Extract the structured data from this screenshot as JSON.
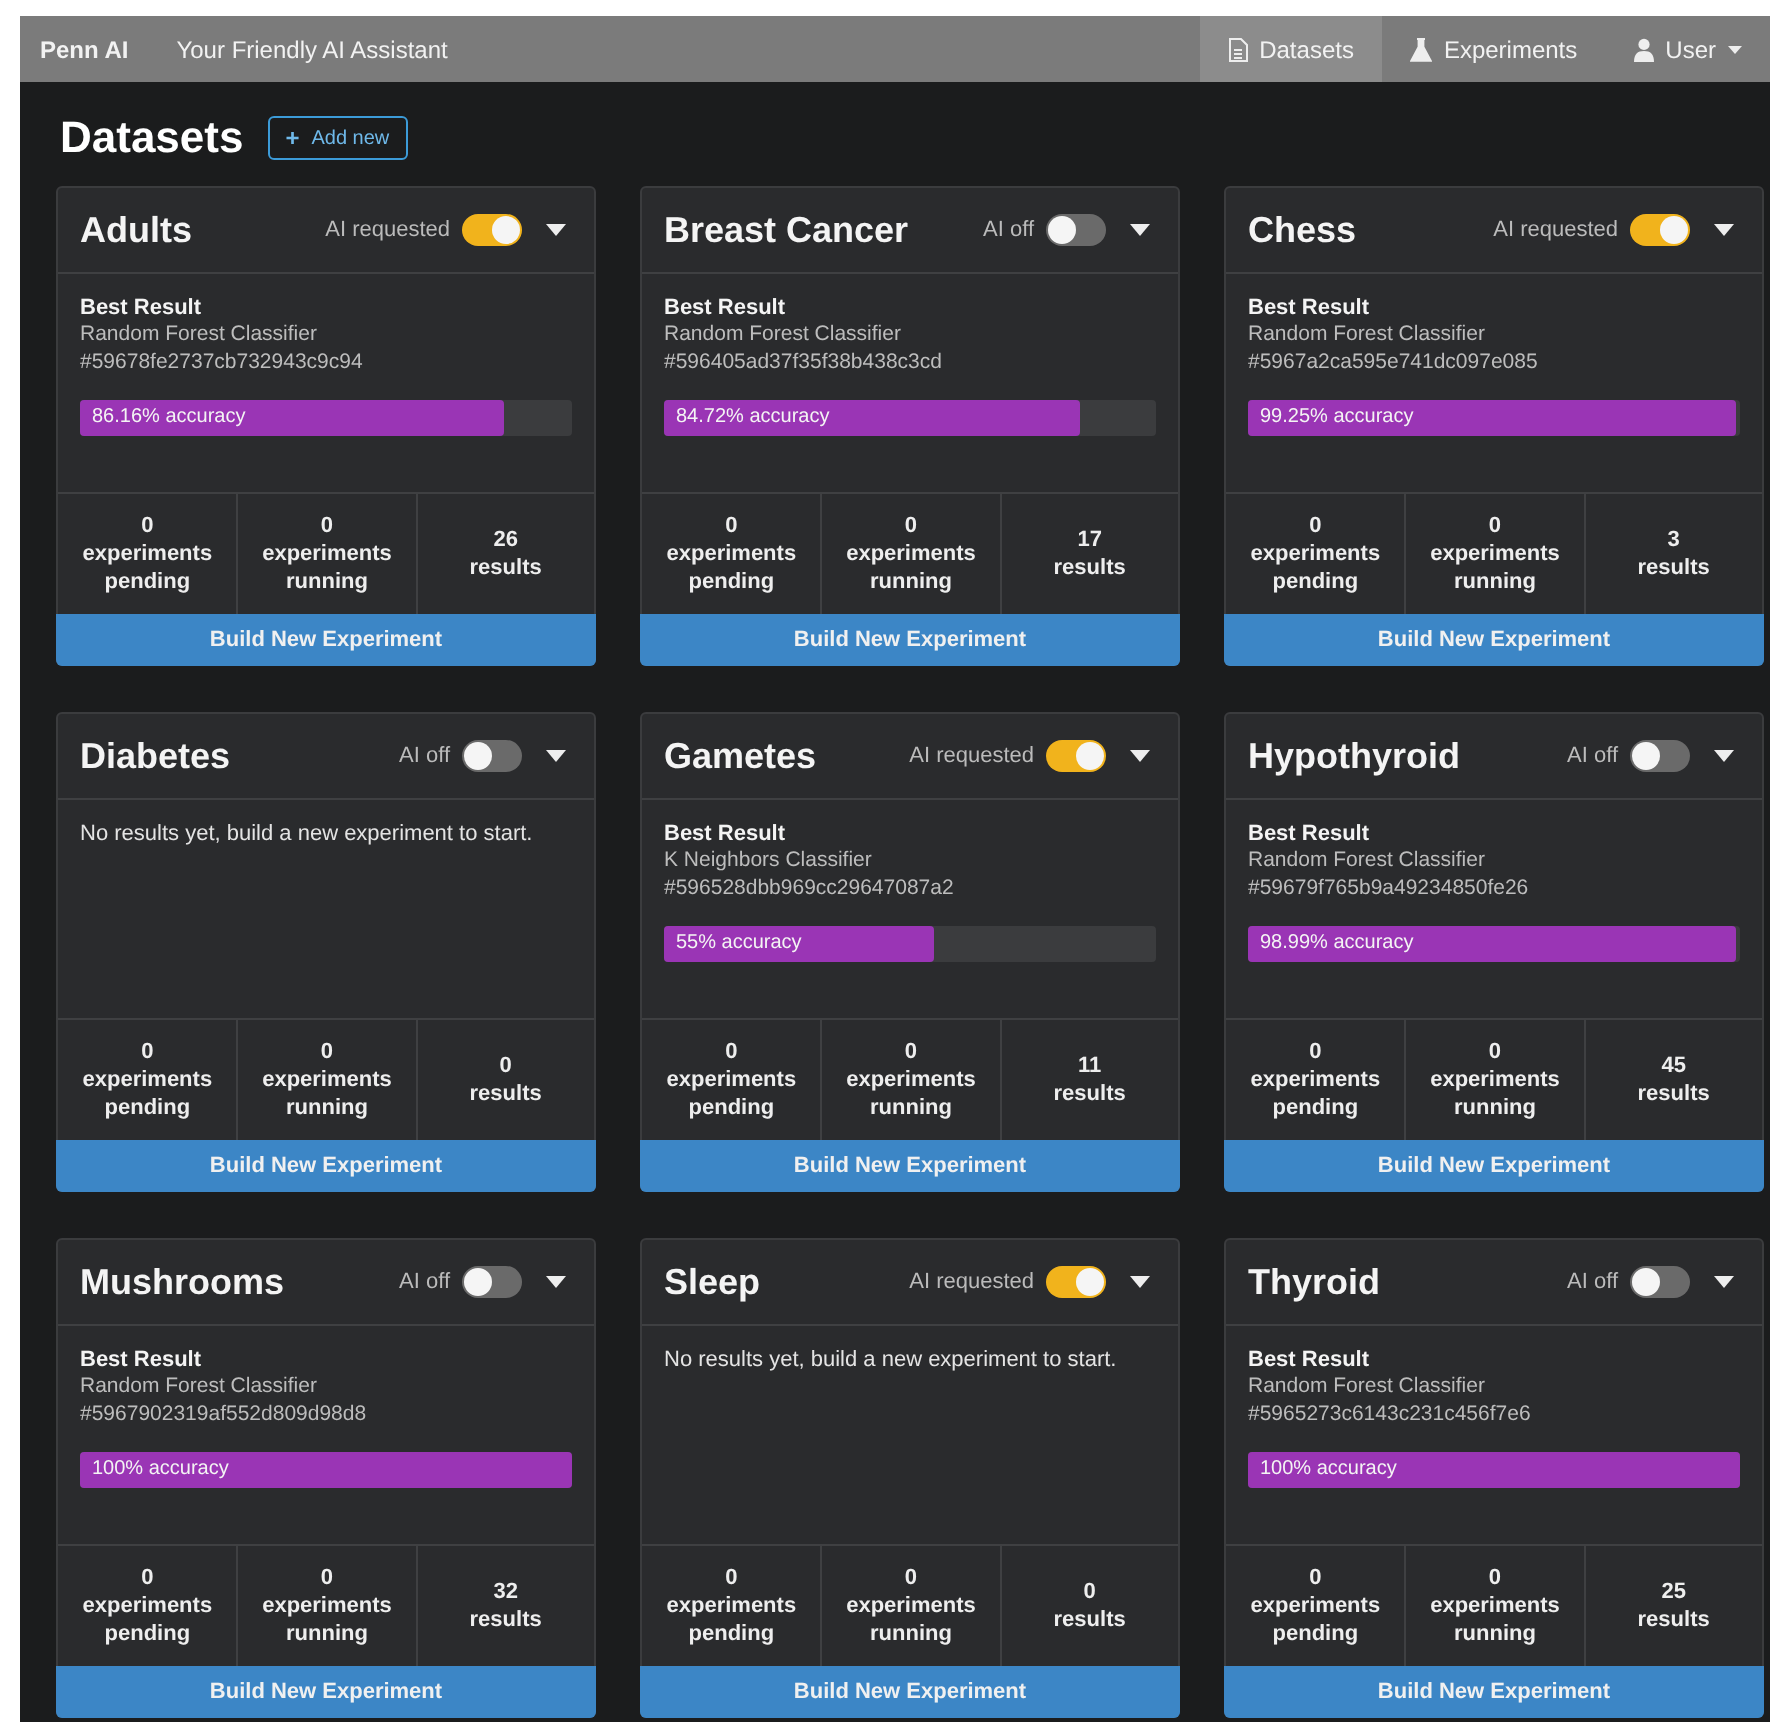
{
  "navbar": {
    "brand": "Penn AI",
    "tagline": "Your Friendly AI Assistant",
    "items": [
      {
        "label": "Datasets",
        "selected": true,
        "caret": false
      },
      {
        "label": "Experiments",
        "selected": false,
        "caret": false
      },
      {
        "label": "User",
        "selected": false,
        "caret": true
      }
    ]
  },
  "page": {
    "title": "Datasets",
    "add_button": "Add new",
    "add_icon": "+"
  },
  "datasets": [
    {
      "name": "Adults",
      "ai_label": "AI requested",
      "ai_on": true,
      "best_result": {
        "heading": "Best Result",
        "algorithm": "Random Forest Classifier",
        "id": "#59678fe2737cb732943c9c94",
        "accuracy": "86.16%  accuracy",
        "level": 0.8616
      },
      "stats": [
        {
          "value": "0",
          "label": "experiments pending"
        },
        {
          "value": "0",
          "label": "experiments running"
        },
        {
          "value": "26",
          "label": "results"
        }
      ],
      "button": "Build New Experiment"
    },
    {
      "name": "Breast Cancer",
      "ai_label": "AI off",
      "ai_on": false,
      "best_result": {
        "heading": "Best Result",
        "algorithm": "Random Forest Classifier",
        "id": "#596405ad37f35f38b438c3cd",
        "accuracy": "84.72%  accuracy",
        "level": 0.8472
      },
      "stats": [
        {
          "value": "0",
          "label": "experiments pending"
        },
        {
          "value": "0",
          "label": "experiments running"
        },
        {
          "value": "17",
          "label": "results"
        }
      ],
      "button": "Build New Experiment"
    },
    {
      "name": "Chess",
      "ai_label": "AI requested",
      "ai_on": true,
      "best_result": {
        "heading": "Best Result",
        "algorithm": "Random Forest Classifier",
        "id": "#5967a2ca595e741dc097e085",
        "accuracy": "99.25%  accuracy",
        "level": 0.9925
      },
      "stats": [
        {
          "value": "0",
          "label": "experiments pending"
        },
        {
          "value": "0",
          "label": "experiments running"
        },
        {
          "value": "3",
          "label": "results"
        }
      ],
      "button": "Build New Experiment"
    },
    {
      "name": "Diabetes",
      "ai_label": "AI off",
      "ai_on": false,
      "empty_message": "No results yet, build a new experiment to start.",
      "stats": [
        {
          "value": "0",
          "label": "experiments pending"
        },
        {
          "value": "0",
          "label": "experiments running"
        },
        {
          "value": "0",
          "label": "results"
        }
      ],
      "button": "Build New Experiment"
    },
    {
      "name": "Gametes",
      "ai_label": "AI requested",
      "ai_on": true,
      "best_result": {
        "heading": "Best Result",
        "algorithm": "K Neighbors Classifier",
        "id": "#596528dbb969cc29647087a2",
        "accuracy": "55%  accuracy",
        "level": 0.55
      },
      "stats": [
        {
          "value": "0",
          "label": "experiments pending"
        },
        {
          "value": "0",
          "label": "experiments running"
        },
        {
          "value": "11",
          "label": "results"
        }
      ],
      "button": "Build New Experiment"
    },
    {
      "name": "Hypothyroid",
      "ai_label": "AI off",
      "ai_on": false,
      "best_result": {
        "heading": "Best Result",
        "algorithm": "Random Forest Classifier",
        "id": "#59679f765b9a49234850fe26",
        "accuracy": "98.99%  accuracy",
        "level": 0.9899
      },
      "stats": [
        {
          "value": "0",
          "label": "experiments pending"
        },
        {
          "value": "0",
          "label": "experiments running"
        },
        {
          "value": "45",
          "label": "results"
        }
      ],
      "button": "Build New Experiment"
    },
    {
      "name": "Mushrooms",
      "ai_label": "AI off",
      "ai_on": false,
      "best_result": {
        "heading": "Best Result",
        "algorithm": "Random Forest Classifier",
        "id": "#5967902319af552d809d98d8",
        "accuracy": "100%  accuracy",
        "level": 1
      },
      "stats": [
        {
          "value": "0",
          "label": "experiments pending"
        },
        {
          "value": "0",
          "label": "experiments running"
        },
        {
          "value": "32",
          "label": "results"
        }
      ],
      "button": "Build New Experiment"
    },
    {
      "name": "Sleep",
      "ai_label": "AI requested",
      "ai_on": true,
      "empty_message": "No results yet, build a new experiment to start.",
      "stats": [
        {
          "value": "0",
          "label": "experiments pending"
        },
        {
          "value": "0",
          "label": "experiments running"
        },
        {
          "value": "0",
          "label": "results"
        }
      ],
      "button": "Build New Experiment"
    },
    {
      "name": "Thyroid",
      "ai_label": "AI off",
      "ai_on": false,
      "best_result": {
        "heading": "Best Result",
        "algorithm": "Random Forest Classifier",
        "id": "#5965273c6143c231c456f7e6",
        "accuracy": "100%  accuracy",
        "level": 1
      },
      "stats": [
        {
          "value": "0",
          "label": "experiments pending"
        },
        {
          "value": "0",
          "label": "experiments running"
        },
        {
          "value": "25",
          "label": "results"
        }
      ],
      "button": "Build New Experiment"
    }
  ]
}
